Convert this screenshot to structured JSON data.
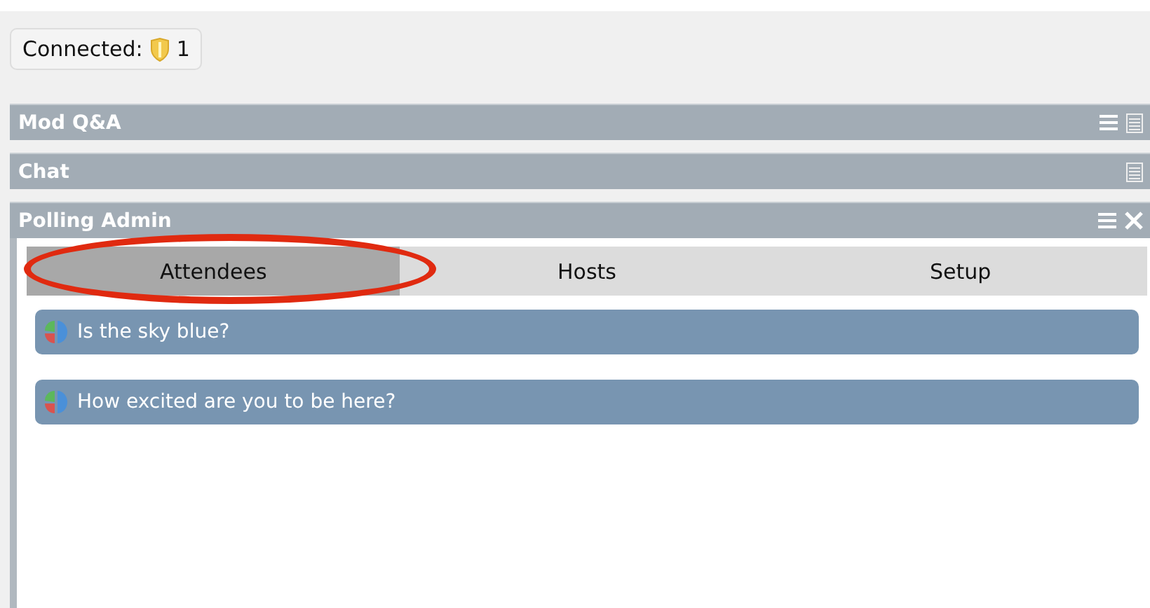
{
  "connected": {
    "label": "Connected:",
    "count": "1"
  },
  "panels": [
    {
      "title": "Mod Q&A",
      "buttons": [
        {
          "kind": "menu"
        },
        {
          "kind": "notes"
        }
      ]
    },
    {
      "title": "Chat",
      "buttons": [
        {
          "kind": "notes"
        }
      ]
    },
    {
      "title": "Polling Admin",
      "buttons": [
        {
          "kind": "menu"
        },
        {
          "kind": "close"
        }
      ],
      "expanded": true,
      "tabs": [
        {
          "label": "Attendees",
          "selected": true
        },
        {
          "label": "Hosts",
          "selected": false
        },
        {
          "label": "Setup",
          "selected": false
        }
      ],
      "questions": [
        {
          "text": "Is the sky blue?"
        },
        {
          "text": "How excited are you to be here?"
        }
      ]
    }
  ]
}
